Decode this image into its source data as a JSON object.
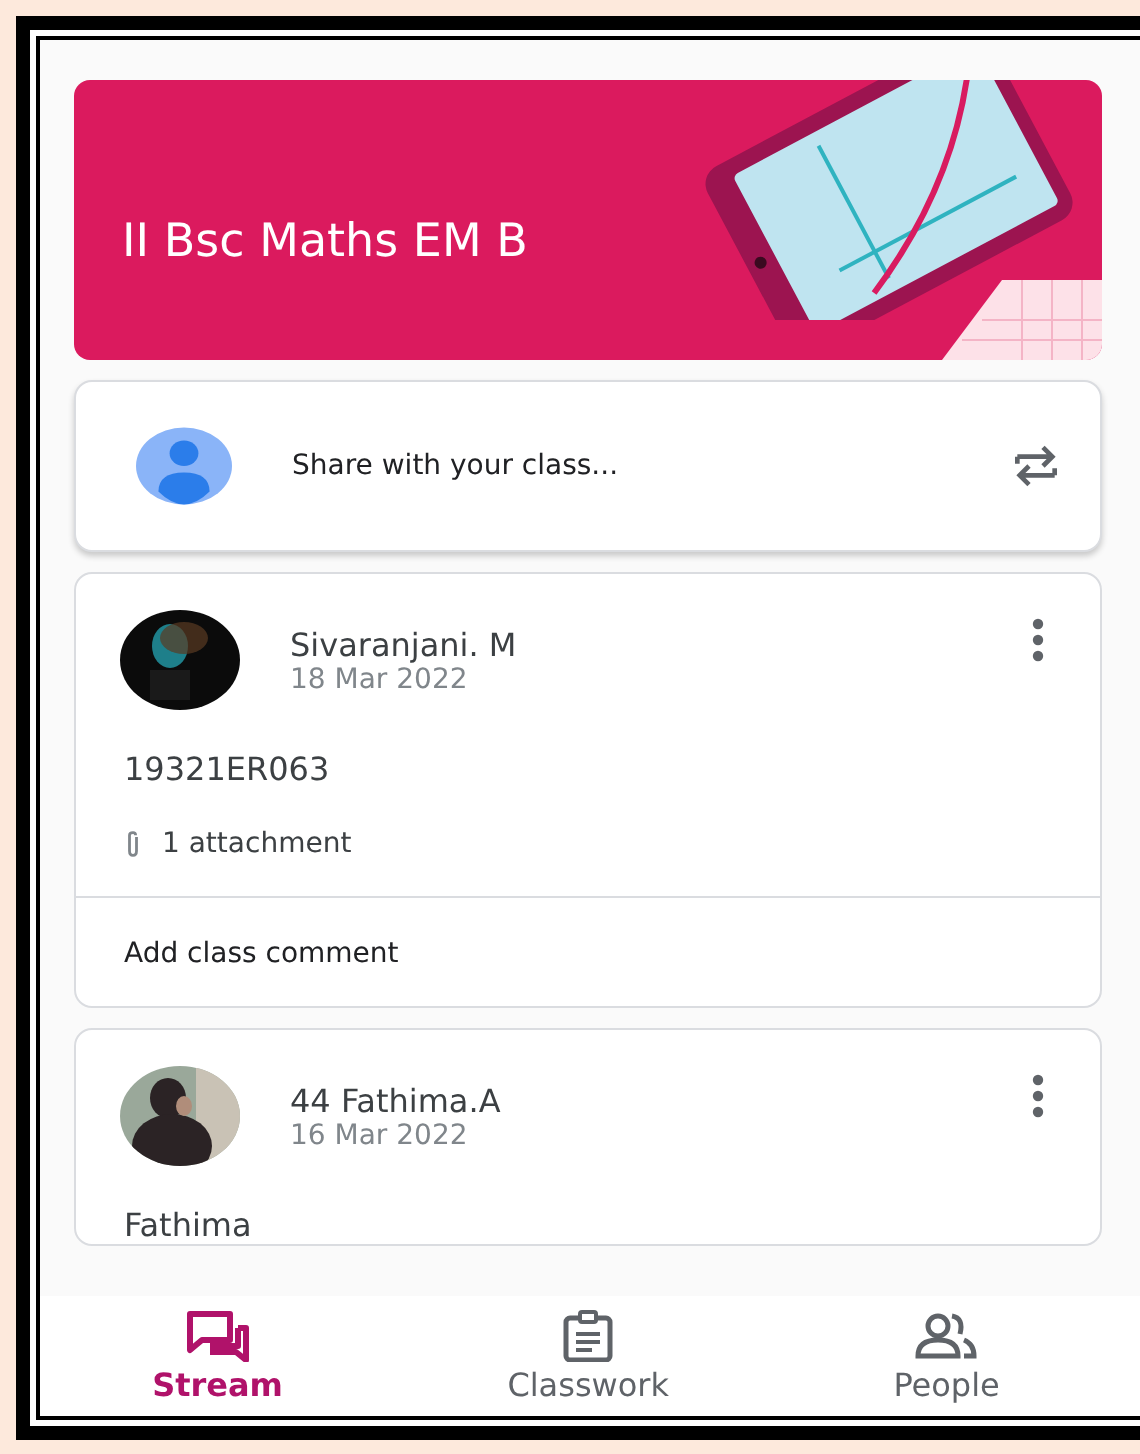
{
  "class_banner": {
    "title": "II Bsc Maths EM B"
  },
  "share": {
    "placeholder": "Share with your class..."
  },
  "posts": [
    {
      "author": "Sivaranjani. M",
      "date": "18 Mar 2022",
      "body": "19321ER063",
      "attachments": "1 attachment",
      "comment": "Add class comment"
    },
    {
      "author": "44 Fathima.A",
      "date": "16 Mar 2022",
      "body": "Fathima"
    }
  ],
  "tabs": [
    {
      "label": "Stream",
      "selected": true,
      "kind": "stream"
    },
    {
      "label": "Classwork",
      "selected": false,
      "kind": "classwork"
    },
    {
      "label": "People",
      "selected": false,
      "kind": "people"
    }
  ]
}
